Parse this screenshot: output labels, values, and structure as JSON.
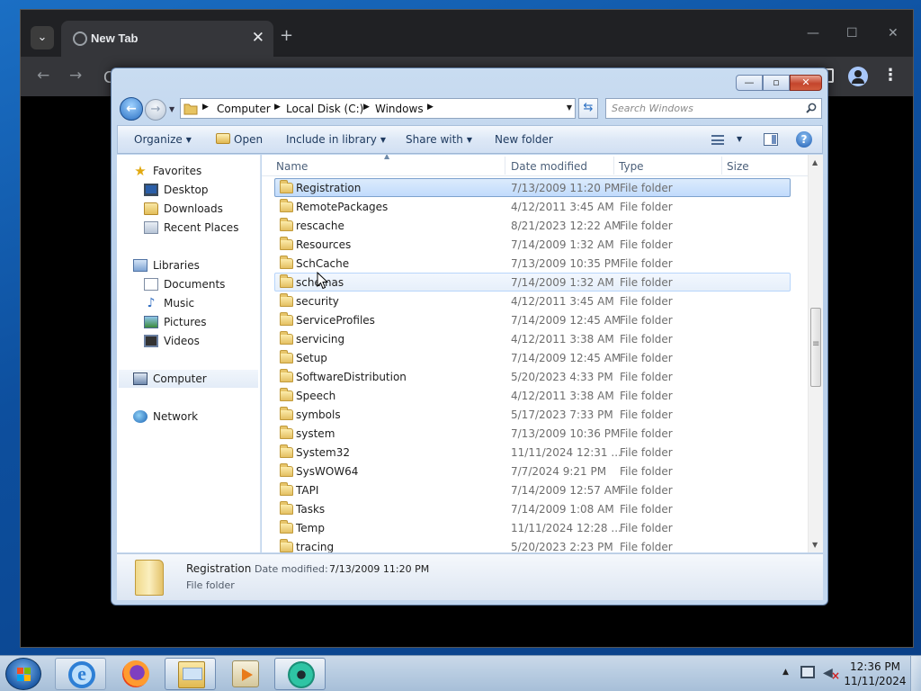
{
  "browser": {
    "tab_title": "New Tab",
    "tab_close": "✕",
    "new_tab": "+",
    "minimize": "—",
    "maximize": "☐",
    "close": "✕",
    "back": "←",
    "forward": "→",
    "omnibox_char": "C",
    "menu": "⋮"
  },
  "explorer": {
    "caption": {
      "minimize": "—",
      "maximize": "▫",
      "close": "✕"
    },
    "address": {
      "crumbs": [
        "Computer",
        "Local Disk (C:)",
        "Windows"
      ],
      "separator": "▶"
    },
    "search": {
      "placeholder": "Search Windows"
    },
    "toolbar": {
      "organize": "Organize",
      "open": "Open",
      "include_in_library": "Include in library",
      "share_with": "Share with",
      "new_folder": "New folder",
      "dropdown_arrow": "▼",
      "help": "?"
    },
    "nav": {
      "favorites": "Favorites",
      "desktop": "Desktop",
      "downloads": "Downloads",
      "recent_places": "Recent Places",
      "libraries": "Libraries",
      "documents": "Documents",
      "music": "Music",
      "pictures": "Pictures",
      "videos": "Videos",
      "computer": "Computer",
      "network": "Network"
    },
    "columns": {
      "name": "Name",
      "date_modified": "Date modified",
      "type": "Type",
      "size": "Size",
      "sort_caret": "▲"
    },
    "files": [
      {
        "name": "Registration",
        "date": "7/13/2009 11:20 PM",
        "type": "File folder",
        "state": "selected"
      },
      {
        "name": "RemotePackages",
        "date": "4/12/2011 3:45 AM",
        "type": "File folder",
        "state": ""
      },
      {
        "name": "rescache",
        "date": "8/21/2023 12:22 AM",
        "type": "File folder",
        "state": ""
      },
      {
        "name": "Resources",
        "date": "7/14/2009 1:32 AM",
        "type": "File folder",
        "state": ""
      },
      {
        "name": "SchCache",
        "date": "7/13/2009 10:35 PM",
        "type": "File folder",
        "state": ""
      },
      {
        "name": "schemas",
        "date": "7/14/2009 1:32 AM",
        "type": "File folder",
        "state": "hover"
      },
      {
        "name": "security",
        "date": "4/12/2011 3:45 AM",
        "type": "File folder",
        "state": ""
      },
      {
        "name": "ServiceProfiles",
        "date": "7/14/2009 12:45 AM",
        "type": "File folder",
        "state": ""
      },
      {
        "name": "servicing",
        "date": "4/12/2011 3:38 AM",
        "type": "File folder",
        "state": ""
      },
      {
        "name": "Setup",
        "date": "7/14/2009 12:45 AM",
        "type": "File folder",
        "state": ""
      },
      {
        "name": "SoftwareDistribution",
        "date": "5/20/2023 4:33 PM",
        "type": "File folder",
        "state": ""
      },
      {
        "name": "Speech",
        "date": "4/12/2011 3:38 AM",
        "type": "File folder",
        "state": ""
      },
      {
        "name": "symbols",
        "date": "5/17/2023 7:33 PM",
        "type": "File folder",
        "state": ""
      },
      {
        "name": "system",
        "date": "7/13/2009 10:36 PM",
        "type": "File folder",
        "state": ""
      },
      {
        "name": "System32",
        "date": "11/11/2024 12:31 ...",
        "type": "File folder",
        "state": ""
      },
      {
        "name": "SysWOW64",
        "date": "7/7/2024 9:21 PM",
        "type": "File folder",
        "state": ""
      },
      {
        "name": "TAPI",
        "date": "7/14/2009 12:57 AM",
        "type": "File folder",
        "state": ""
      },
      {
        "name": "Tasks",
        "date": "7/14/2009 1:08 AM",
        "type": "File folder",
        "state": ""
      },
      {
        "name": "Temp",
        "date": "11/11/2024 12:28 ...",
        "type": "File folder",
        "state": ""
      },
      {
        "name": "tracing",
        "date": "5/20/2023 2:23 PM",
        "type": "File folder",
        "state": ""
      }
    ],
    "details": {
      "name": "Registration",
      "date_label": "Date modified:",
      "date_value": "7/13/2009 11:20 PM",
      "type": "File folder"
    }
  },
  "taskbar": {
    "time": "12:36 PM",
    "date": "11/11/2024",
    "ie_letter": "e",
    "tray_arrow": "▲",
    "speaker": "◀"
  }
}
